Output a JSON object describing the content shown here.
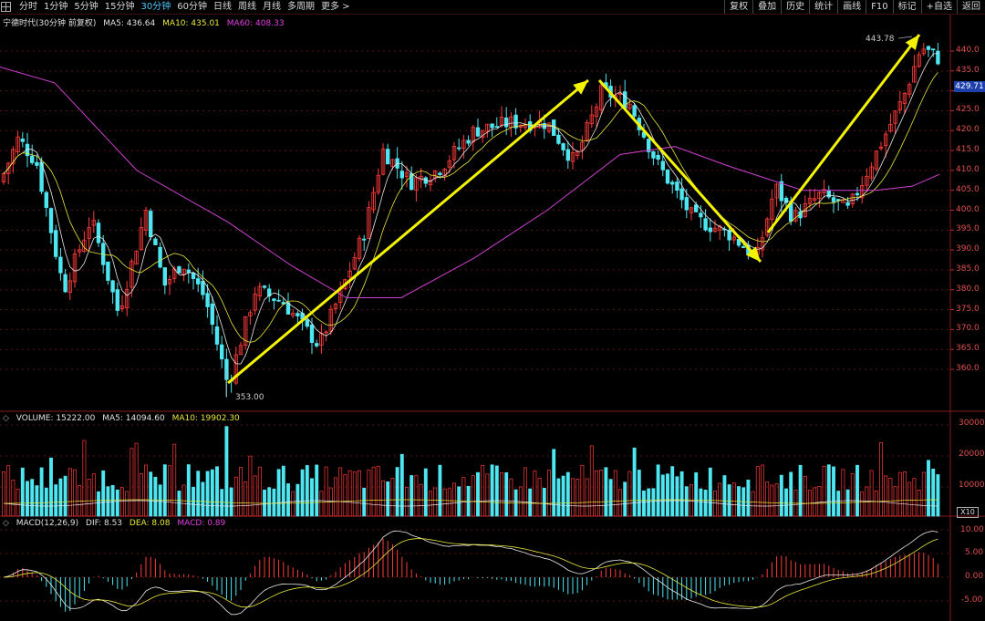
{
  "toolbar": {
    "tabs": [
      {
        "label": "分时",
        "active": false
      },
      {
        "label": "1分钟",
        "active": false
      },
      {
        "label": "5分钟",
        "active": false
      },
      {
        "label": "15分钟",
        "active": false
      },
      {
        "label": "30分钟",
        "active": true
      },
      {
        "label": "60分钟",
        "active": false
      },
      {
        "label": "日线",
        "active": false
      },
      {
        "label": "周线",
        "active": false
      },
      {
        "label": "月线",
        "active": false
      },
      {
        "label": "多周期",
        "active": false
      },
      {
        "label": "更多 >",
        "active": false
      }
    ],
    "buttons": [
      "复权",
      "叠加",
      "历史",
      "统计",
      "画线",
      "F10",
      "标记",
      "+自选",
      "返回"
    ]
  },
  "price_panel": {
    "title": "宁德时代(30分钟 前复权)",
    "ma5": "MA5: 436.64",
    "ma10": "MA10: 435.01",
    "ma60": "MA60: 408.33",
    "high_label": "443.78",
    "low_label": "353.00",
    "current_price": "429.71",
    "y_ticks": [
      "440.0",
      "435.0",
      "430.0",
      "425.0",
      "420.0",
      "415.0",
      "410.0",
      "405.0",
      "400.0",
      "395.0",
      "390.0",
      "385.0",
      "380.0",
      "375.0",
      "370.0",
      "365.0",
      "360.0"
    ]
  },
  "volume_panel": {
    "vol": "VOLUME: 15222.00",
    "ma5": "MA5: 14094.60",
    "ma10": "MA10: 19902.30",
    "y_ticks": [
      "30000",
      "20000",
      "10000"
    ],
    "unit": "X10"
  },
  "macd_panel": {
    "title": "MACD(12,26,9)",
    "dif": "DIF: 8.53",
    "dea": "DEA: 8.08",
    "macd": "MACD: 0.89",
    "y_ticks": [
      "10.00",
      "5.00",
      "0.00",
      "-5.00"
    ]
  },
  "colors": {
    "up": "#ff3b3b",
    "down": "#4ee6f0",
    "ma5": "#e8e8e8",
    "ma10": "#e8e83a",
    "ma60": "#d040d0",
    "arrow": "#f4f400"
  },
  "chart_data": {
    "type": "candlestick",
    "trend_keypoints": [
      {
        "label": "low",
        "value": 353.0
      },
      {
        "label": "peak",
        "value": 431
      },
      {
        "label": "trough",
        "value": 388
      },
      {
        "label": "high",
        "value": 443.78
      }
    ],
    "ylim": [
      355,
      442
    ]
  }
}
